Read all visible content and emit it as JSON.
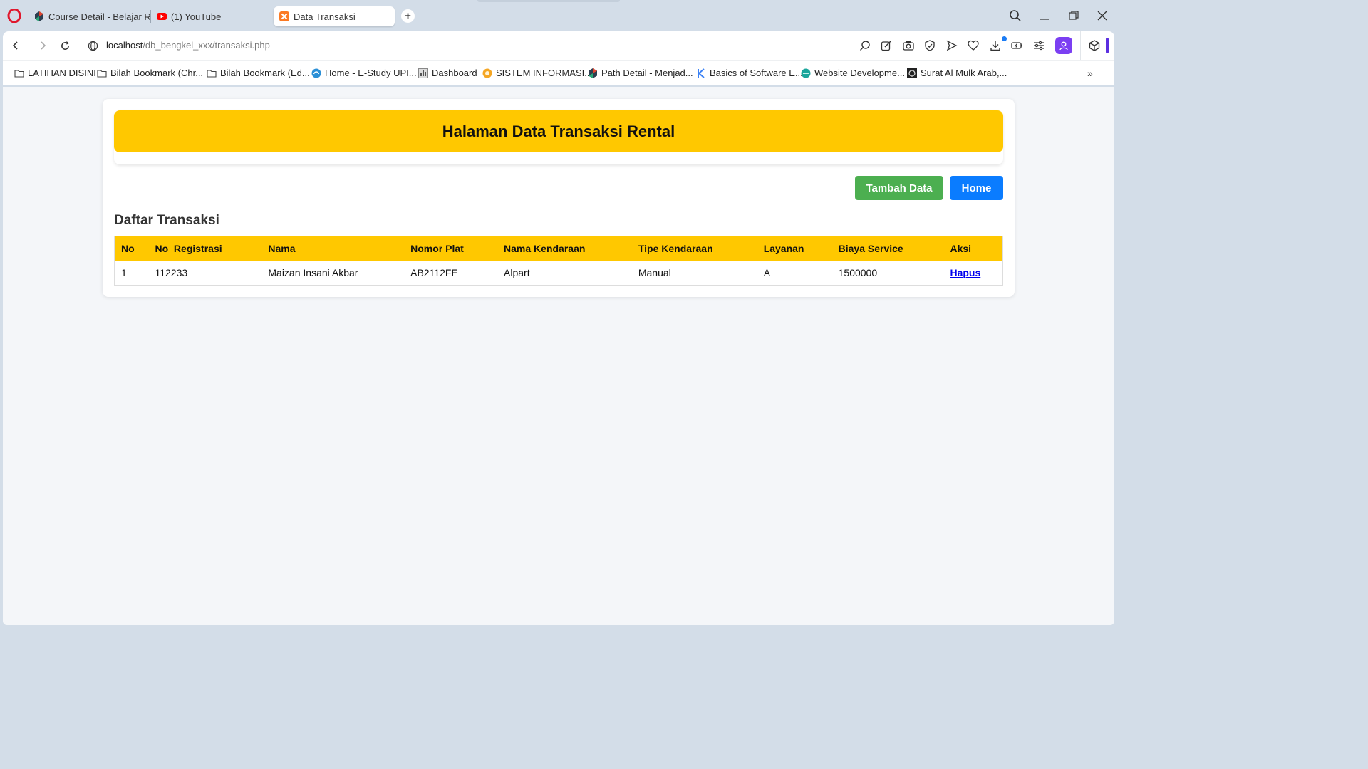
{
  "browser": {
    "tabs": [
      {
        "title": "Course Detail - Belajar Re",
        "icon": "dicoding-icon"
      },
      {
        "title": "(1) YouTube",
        "icon": "youtube-icon"
      },
      {
        "title": "Data Transaksi",
        "icon": "xampp-icon",
        "active": true
      }
    ],
    "new_tab_label": "+",
    "url_host": "localhost",
    "url_path": "/db_bengkel_xxx/transaksi.php",
    "bookmarks": [
      {
        "label": "LATIHAN DISINI",
        "icon": "folder-icon"
      },
      {
        "label": "Bilah Bookmark (Chr...",
        "icon": "folder-icon"
      },
      {
        "label": "Bilah Bookmark (Ed...",
        "icon": "folder-icon"
      },
      {
        "label": "Home - E-Study UPI...",
        "icon": "upi-icon"
      },
      {
        "label": "Dashboard",
        "icon": "dashboard-icon"
      },
      {
        "label": "SISTEM INFORMASI...",
        "icon": "sistem-informasi-icon"
      },
      {
        "label": "Path Detail - Menjad...",
        "icon": "dicoding-icon"
      },
      {
        "label": "Basics of Software E...",
        "icon": "k-icon"
      },
      {
        "label": "Website Developme...",
        "icon": "website-icon"
      },
      {
        "label": "Surat Al Mulk Arab,...",
        "icon": "quran-icon"
      }
    ],
    "colors": {
      "chrome": "#d3dde8",
      "profile": "#7b3ff2",
      "accent_bar": "#5b2fe0"
    }
  },
  "page": {
    "header_title": "Halaman Data Transaksi Rental",
    "add_button": "Tambah Data",
    "home_button": "Home",
    "section_title": "Daftar Transaksi",
    "table": {
      "columns": [
        "No",
        "No_Registrasi",
        "Nama",
        "Nomor Plat",
        "Nama Kendaraan",
        "Tipe Kendaraan",
        "Layanan",
        "Biaya Service",
        "Aksi"
      ],
      "rows": [
        {
          "no": "1",
          "no_registrasi": "112233",
          "nama": "Maizan Insani Akbar",
          "nomor_plat": "AB2112FE",
          "nama_kendaraan": "Alpart",
          "tipe_kendaraan": "Manual",
          "layanan": "A",
          "biaya_service": "1500000",
          "aksi": "Hapus"
        }
      ]
    },
    "colors": {
      "header": "#ffc800",
      "add_button": "#4caf50",
      "home_button": "#0a7cff",
      "link": "#0000ee"
    }
  }
}
